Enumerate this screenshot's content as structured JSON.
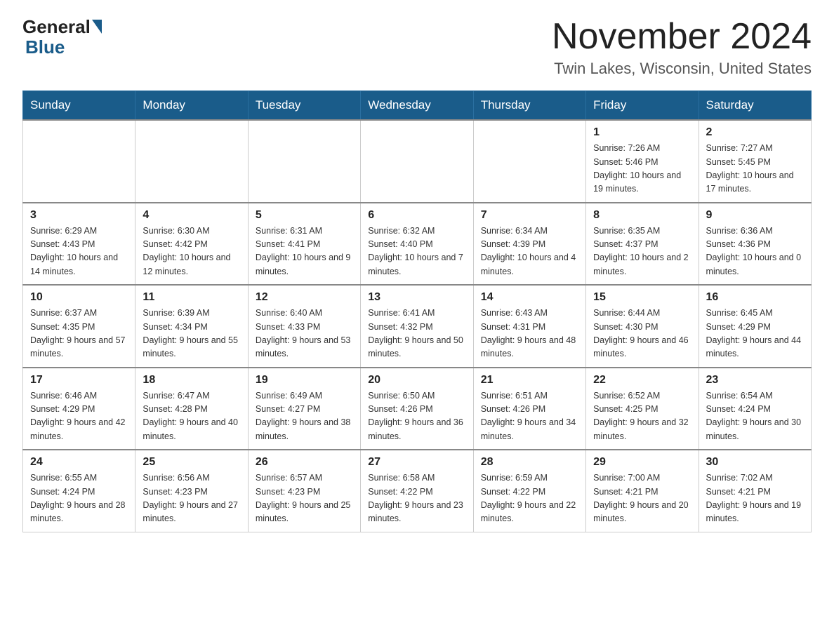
{
  "header": {
    "logo_general": "General",
    "logo_blue": "Blue",
    "main_title": "November 2024",
    "subtitle": "Twin Lakes, Wisconsin, United States"
  },
  "days_of_week": [
    "Sunday",
    "Monday",
    "Tuesday",
    "Wednesday",
    "Thursday",
    "Friday",
    "Saturday"
  ],
  "weeks": [
    [
      {
        "day": "",
        "info": ""
      },
      {
        "day": "",
        "info": ""
      },
      {
        "day": "",
        "info": ""
      },
      {
        "day": "",
        "info": ""
      },
      {
        "day": "",
        "info": ""
      },
      {
        "day": "1",
        "info": "Sunrise: 7:26 AM\nSunset: 5:46 PM\nDaylight: 10 hours and 19 minutes."
      },
      {
        "day": "2",
        "info": "Sunrise: 7:27 AM\nSunset: 5:45 PM\nDaylight: 10 hours and 17 minutes."
      }
    ],
    [
      {
        "day": "3",
        "info": "Sunrise: 6:29 AM\nSunset: 4:43 PM\nDaylight: 10 hours and 14 minutes."
      },
      {
        "day": "4",
        "info": "Sunrise: 6:30 AM\nSunset: 4:42 PM\nDaylight: 10 hours and 12 minutes."
      },
      {
        "day": "5",
        "info": "Sunrise: 6:31 AM\nSunset: 4:41 PM\nDaylight: 10 hours and 9 minutes."
      },
      {
        "day": "6",
        "info": "Sunrise: 6:32 AM\nSunset: 4:40 PM\nDaylight: 10 hours and 7 minutes."
      },
      {
        "day": "7",
        "info": "Sunrise: 6:34 AM\nSunset: 4:39 PM\nDaylight: 10 hours and 4 minutes."
      },
      {
        "day": "8",
        "info": "Sunrise: 6:35 AM\nSunset: 4:37 PM\nDaylight: 10 hours and 2 minutes."
      },
      {
        "day": "9",
        "info": "Sunrise: 6:36 AM\nSunset: 4:36 PM\nDaylight: 10 hours and 0 minutes."
      }
    ],
    [
      {
        "day": "10",
        "info": "Sunrise: 6:37 AM\nSunset: 4:35 PM\nDaylight: 9 hours and 57 minutes."
      },
      {
        "day": "11",
        "info": "Sunrise: 6:39 AM\nSunset: 4:34 PM\nDaylight: 9 hours and 55 minutes."
      },
      {
        "day": "12",
        "info": "Sunrise: 6:40 AM\nSunset: 4:33 PM\nDaylight: 9 hours and 53 minutes."
      },
      {
        "day": "13",
        "info": "Sunrise: 6:41 AM\nSunset: 4:32 PM\nDaylight: 9 hours and 50 minutes."
      },
      {
        "day": "14",
        "info": "Sunrise: 6:43 AM\nSunset: 4:31 PM\nDaylight: 9 hours and 48 minutes."
      },
      {
        "day": "15",
        "info": "Sunrise: 6:44 AM\nSunset: 4:30 PM\nDaylight: 9 hours and 46 minutes."
      },
      {
        "day": "16",
        "info": "Sunrise: 6:45 AM\nSunset: 4:29 PM\nDaylight: 9 hours and 44 minutes."
      }
    ],
    [
      {
        "day": "17",
        "info": "Sunrise: 6:46 AM\nSunset: 4:29 PM\nDaylight: 9 hours and 42 minutes."
      },
      {
        "day": "18",
        "info": "Sunrise: 6:47 AM\nSunset: 4:28 PM\nDaylight: 9 hours and 40 minutes."
      },
      {
        "day": "19",
        "info": "Sunrise: 6:49 AM\nSunset: 4:27 PM\nDaylight: 9 hours and 38 minutes."
      },
      {
        "day": "20",
        "info": "Sunrise: 6:50 AM\nSunset: 4:26 PM\nDaylight: 9 hours and 36 minutes."
      },
      {
        "day": "21",
        "info": "Sunrise: 6:51 AM\nSunset: 4:26 PM\nDaylight: 9 hours and 34 minutes."
      },
      {
        "day": "22",
        "info": "Sunrise: 6:52 AM\nSunset: 4:25 PM\nDaylight: 9 hours and 32 minutes."
      },
      {
        "day": "23",
        "info": "Sunrise: 6:54 AM\nSunset: 4:24 PM\nDaylight: 9 hours and 30 minutes."
      }
    ],
    [
      {
        "day": "24",
        "info": "Sunrise: 6:55 AM\nSunset: 4:24 PM\nDaylight: 9 hours and 28 minutes."
      },
      {
        "day": "25",
        "info": "Sunrise: 6:56 AM\nSunset: 4:23 PM\nDaylight: 9 hours and 27 minutes."
      },
      {
        "day": "26",
        "info": "Sunrise: 6:57 AM\nSunset: 4:23 PM\nDaylight: 9 hours and 25 minutes."
      },
      {
        "day": "27",
        "info": "Sunrise: 6:58 AM\nSunset: 4:22 PM\nDaylight: 9 hours and 23 minutes."
      },
      {
        "day": "28",
        "info": "Sunrise: 6:59 AM\nSunset: 4:22 PM\nDaylight: 9 hours and 22 minutes."
      },
      {
        "day": "29",
        "info": "Sunrise: 7:00 AM\nSunset: 4:21 PM\nDaylight: 9 hours and 20 minutes."
      },
      {
        "day": "30",
        "info": "Sunrise: 7:02 AM\nSunset: 4:21 PM\nDaylight: 9 hours and 19 minutes."
      }
    ]
  ]
}
